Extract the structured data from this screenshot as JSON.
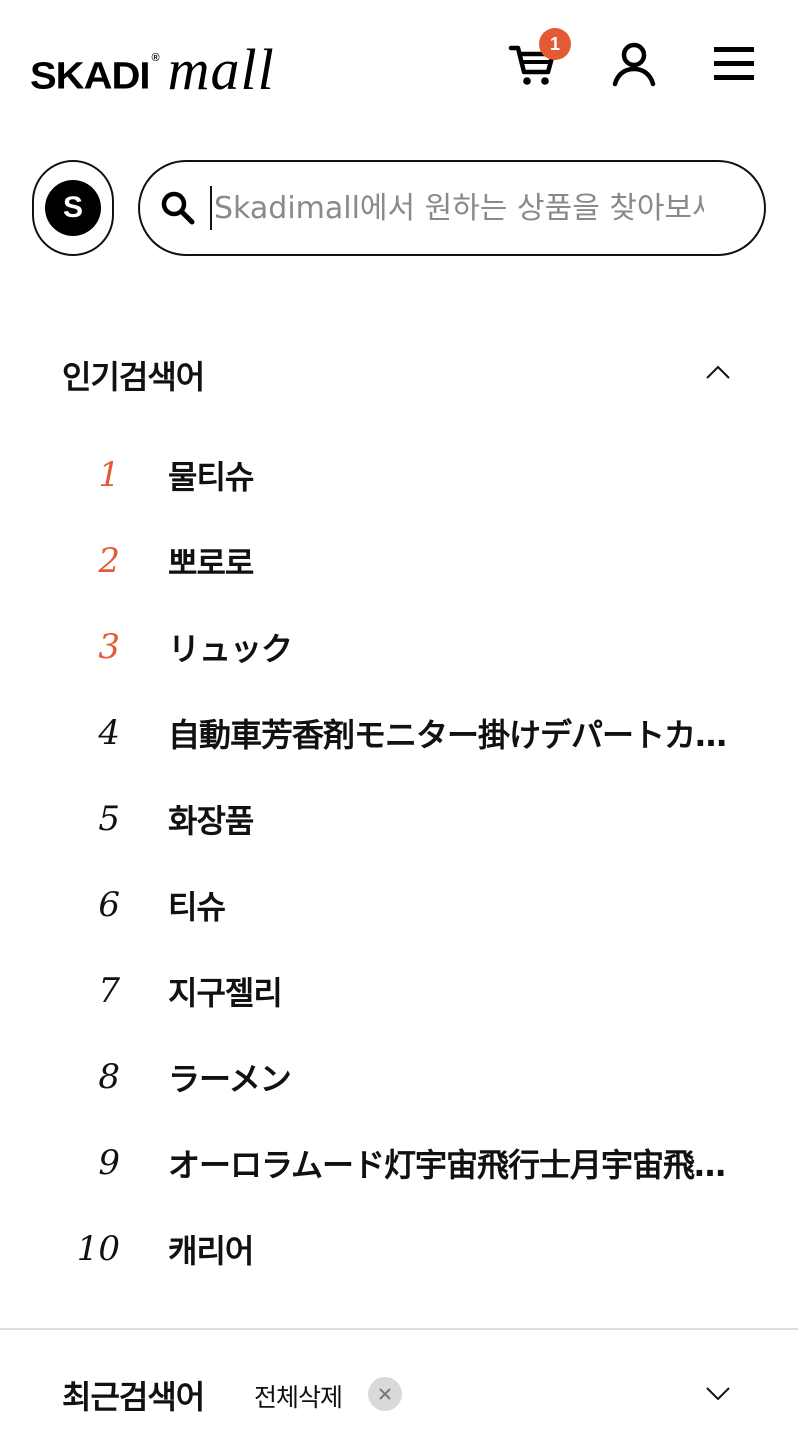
{
  "header": {
    "logo_brand": "SKADI",
    "logo_reg": "®",
    "logo_mall": "mall",
    "cart_count": "1"
  },
  "search": {
    "shortcut_letter": "S",
    "value": "",
    "placeholder": "Skadimall에서 원하는 상품을 찾아보세요"
  },
  "popular": {
    "title": "인기검색어",
    "items": [
      {
        "rank": "1",
        "word": "물티슈"
      },
      {
        "rank": "2",
        "word": "뽀로로"
      },
      {
        "rank": "3",
        "word": "リュック"
      },
      {
        "rank": "4",
        "word": "自動車芳香剤モニター掛けデパートカー用品"
      },
      {
        "rank": "5",
        "word": "화장품"
      },
      {
        "rank": "6",
        "word": "티슈"
      },
      {
        "rank": "7",
        "word": "지구젤리"
      },
      {
        "rank": "8",
        "word": "ラーメン"
      },
      {
        "rank": "9",
        "word": "オーロラムード灯宇宙飛行士月宇宙飛行士"
      },
      {
        "rank": "10",
        "word": "캐리어"
      }
    ]
  },
  "recent": {
    "title": "최근검색어",
    "clear_all_label": "전체삭제"
  },
  "colors": {
    "accent": "#e45a35",
    "text": "#111111",
    "divider": "#dcdcdc",
    "placeholder": "#8a8a8a"
  },
  "icons": {
    "cart": "cart-icon",
    "user": "user-icon",
    "menu": "menu-icon",
    "search": "search-icon",
    "collapse": "chevron-up-icon",
    "expand": "chevron-down-icon",
    "clear": "close-icon"
  }
}
